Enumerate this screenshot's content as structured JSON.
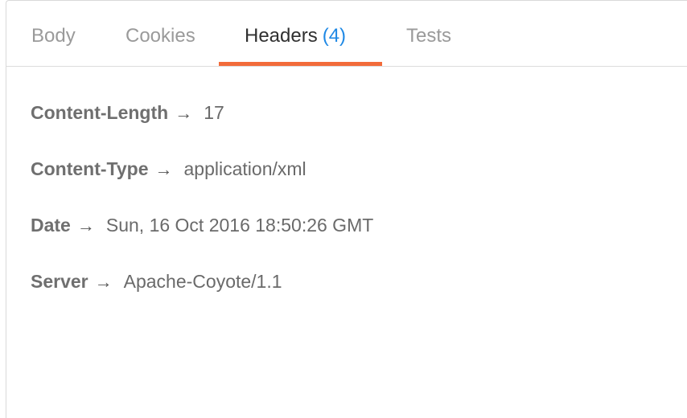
{
  "tabs": [
    {
      "label": "Body",
      "count": ""
    },
    {
      "label": "Cookies",
      "count": ""
    },
    {
      "label": "Headers",
      "count": "(4)"
    },
    {
      "label": "Tests",
      "count": ""
    }
  ],
  "active_tab": "Headers",
  "colors": {
    "accent_underline": "#f26b3a",
    "count_badge": "#1e88e5"
  },
  "arrow_icon": "right-arrow-icon",
  "headers": [
    {
      "key": "Content-Length",
      "value": "17"
    },
    {
      "key": "Content-Type",
      "value": "application/xml"
    },
    {
      "key": "Date",
      "value": "Sun, 16 Oct 2016 18:50:26 GMT"
    },
    {
      "key": "Server",
      "value": "Apache-Coyote/1.1"
    }
  ]
}
